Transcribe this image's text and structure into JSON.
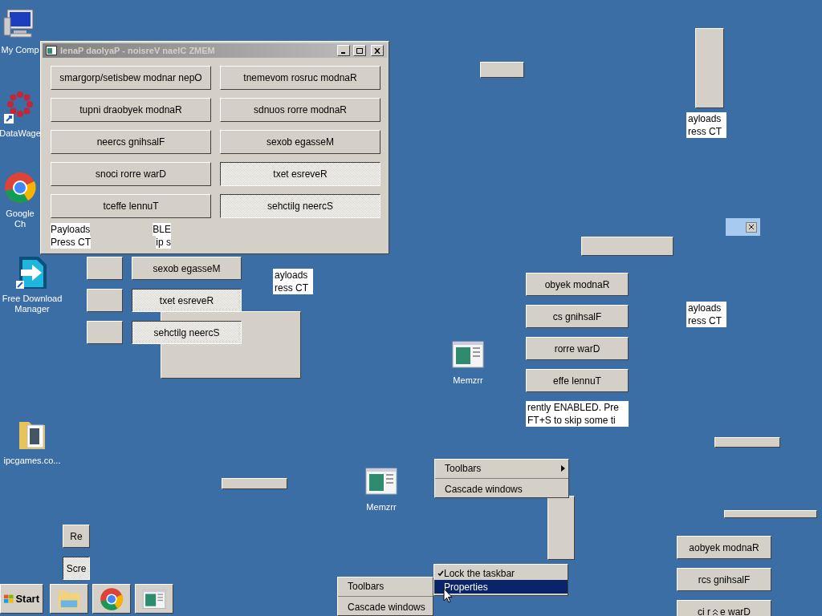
{
  "desktop_icons": [
    {
      "kind": "computer",
      "label": "My Comp"
    },
    {
      "kind": "flower",
      "label": "DataWage"
    },
    {
      "kind": "chrome",
      "label": "Google Ch"
    },
    {
      "kind": "download",
      "label": "Free Download Manager"
    },
    {
      "kind": "folder",
      "label": "ipcgames.co..."
    },
    {
      "kind": "app",
      "label": "Memzrr"
    },
    {
      "kind": "app",
      "label": "Memzrr"
    }
  ],
  "window": {
    "title": "lenaP daolyaP - noisreV naelC ZMEM",
    "buttons": [
      {
        "label": "smargorp/setisbew modnar nepO",
        "on": false
      },
      {
        "label": "tnemevom rosruc modnaR",
        "on": false
      },
      {
        "label": "tupni draobyek modnaR",
        "on": false
      },
      {
        "label": "sdnuos rorre modnaR",
        "on": false
      },
      {
        "label": "neercs gnihsalF",
        "on": false
      },
      {
        "label": "sexob egasseM",
        "on": false
      },
      {
        "label": "snoci rorre warD",
        "on": false
      },
      {
        "label": "txet esreveR",
        "on": true
      },
      {
        "label": "tceffe lennuT",
        "on": false
      },
      {
        "label": "sehctilg neercS",
        "on": true
      }
    ],
    "status_lines": [
      {
        "start": "Payloads",
        "end": "BLE"
      },
      {
        "start": "Press CT",
        "end": "ip s"
      }
    ]
  },
  "glitch_copies": [
    {
      "items": [
        {
          "kind": "button",
          "label": "sexob egasseM"
        },
        {
          "kind": "toggle",
          "label": "txet esreveR",
          "on": true
        },
        {
          "kind": "toggle",
          "label": "sehctilg neercS",
          "on": true
        }
      ]
    },
    {
      "items": [
        {
          "kind": "status",
          "label": "ayloads"
        },
        {
          "kind": "status",
          "label": "ress CT"
        }
      ]
    },
    {
      "items": [
        {
          "kind": "button",
          "label": "obyek modnaR"
        },
        {
          "kind": "button",
          "label": "cs gnihsalF"
        },
        {
          "kind": "button",
          "label": "rorre warD"
        },
        {
          "kind": "button",
          "label": "effe lennuT"
        },
        {
          "kind": "status",
          "label": "rently ENABLED. Pre"
        },
        {
          "kind": "status",
          "label": "FT+S to skip some ti"
        }
      ]
    },
    {
      "items": [
        {
          "kind": "status",
          "label": "ayloads"
        },
        {
          "kind": "status",
          "label": "ress CT"
        }
      ]
    },
    {
      "items": [
        {
          "kind": "status",
          "label": "ayloads"
        },
        {
          "kind": "status",
          "label": "ress CT"
        }
      ]
    },
    {
      "items": [
        {
          "kind": "button",
          "label": "aobyek modnaR"
        },
        {
          "kind": "button",
          "label": "rcs gnihsalF"
        },
        {
          "kind": "split",
          "label": "ci r",
          "label2": "e warD"
        }
      ]
    },
    {
      "items": [
        {
          "kind": "button",
          "label": "Re"
        },
        {
          "kind": "toggle",
          "label": "Scre",
          "on": true
        }
      ]
    }
  ],
  "context_menus": [
    {
      "items": [
        {
          "label": "Toolbars",
          "submenu": true,
          "checked": false,
          "selected": false
        },
        {
          "label": "Cascade windows",
          "submenu": false,
          "checked": false,
          "selected": false
        }
      ]
    },
    {
      "items": [
        {
          "label": "Lock the taskbar",
          "submenu": false,
          "checked": true,
          "selected": false
        },
        {
          "label": "Properties",
          "submenu": false,
          "checked": false,
          "selected": true
        }
      ]
    },
    {
      "items": [
        {
          "label": "Toolbars",
          "submenu": false,
          "checked": false,
          "selected": false
        },
        {
          "label": "Cascade windows",
          "submenu": false,
          "checked": false,
          "selected": false
        }
      ]
    }
  ],
  "taskbar": {
    "start_label": "Start",
    "buttons": [
      {
        "kind": "explorer"
      },
      {
        "kind": "chrome"
      },
      {
        "kind": "app"
      }
    ]
  }
}
